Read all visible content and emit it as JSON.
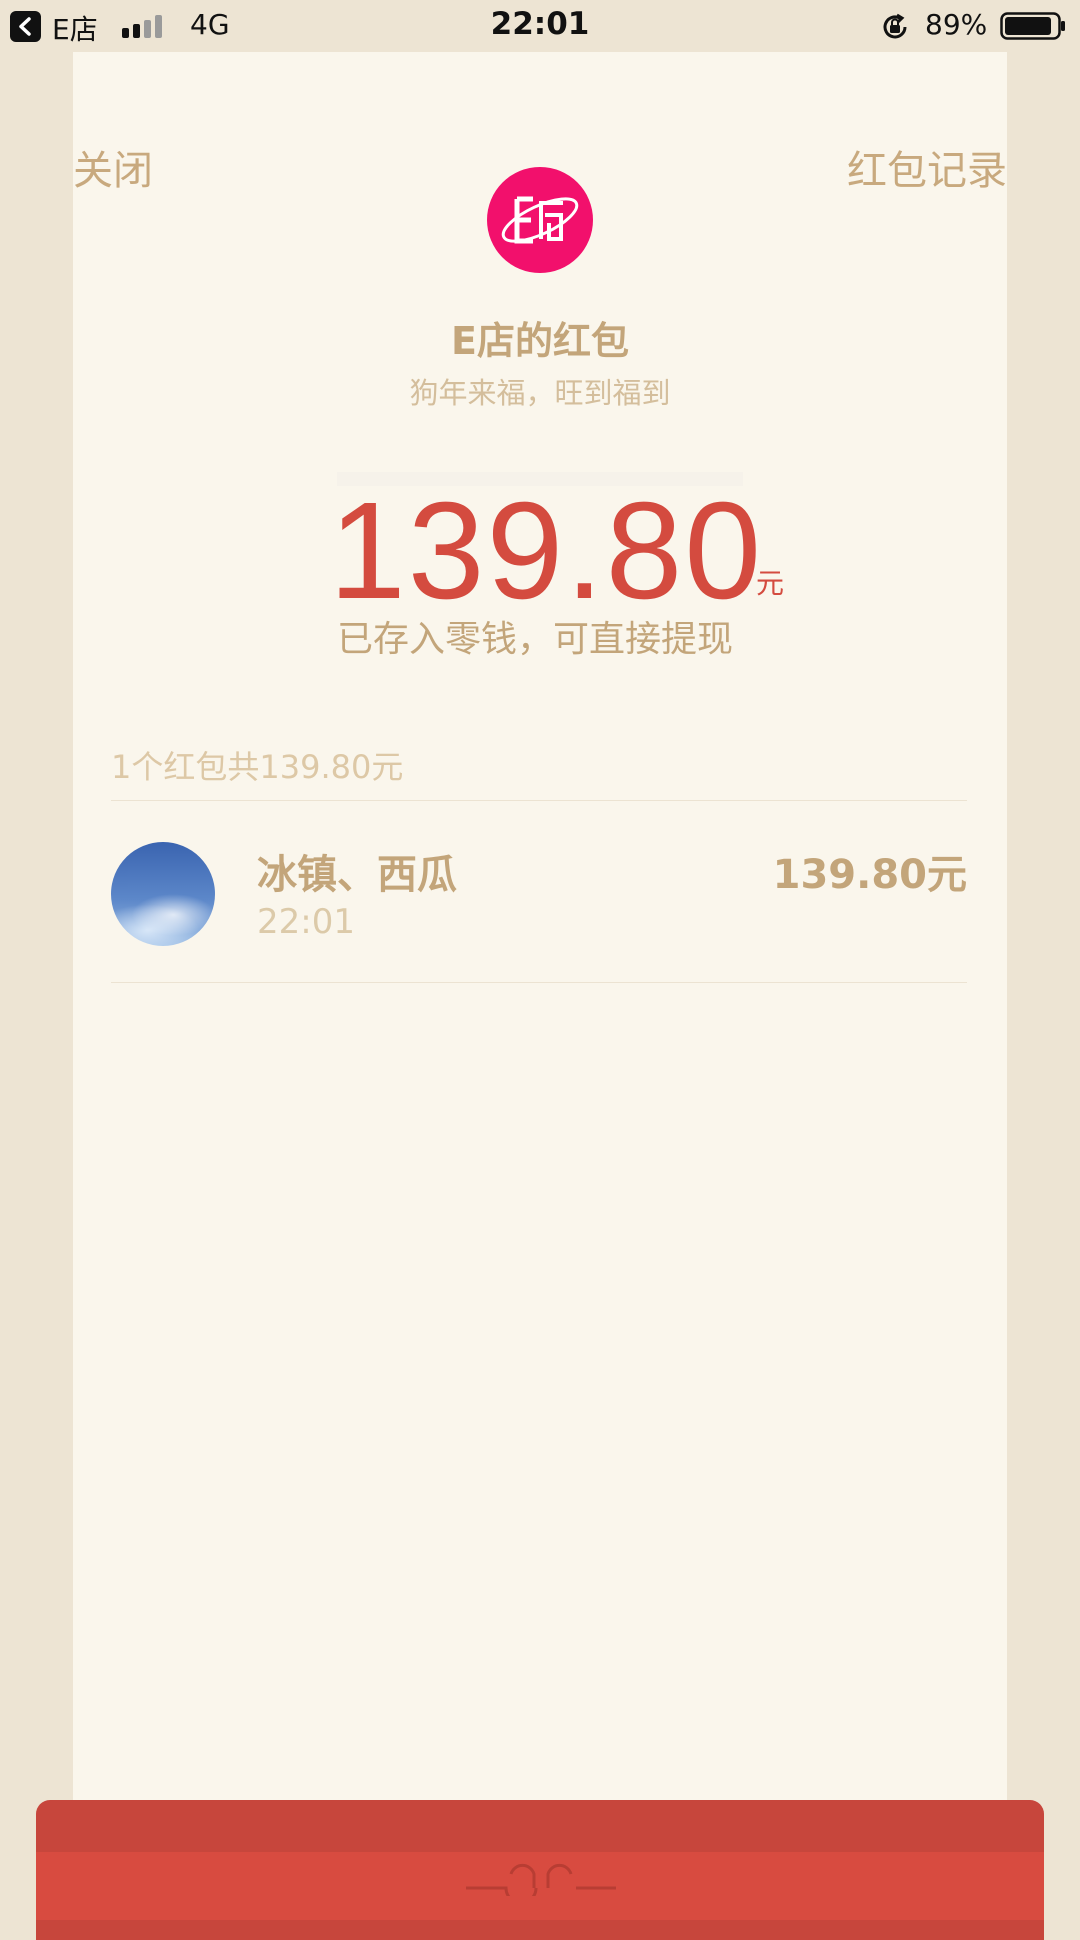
{
  "status_bar": {
    "back_app_label": "E店",
    "network": "4G",
    "time": "22:01",
    "battery_percent": "89%",
    "battery_level": 0.89
  },
  "header": {
    "close_label": "关闭",
    "records_label": "红包记录"
  },
  "envelope": {
    "sender_title": "E店的红包",
    "greeting": "狗年来福，旺到福到",
    "amount": "139.80",
    "unit": "元",
    "note": "已存入零钱，可直接提现"
  },
  "summary": {
    "text": "1个红包共139.80元"
  },
  "recipients": [
    {
      "name": "冰镇、西瓜",
      "time": "22:01",
      "amount": "139.80元"
    }
  ],
  "colors": {
    "accent_gold": "#c3a57a",
    "amount_red": "#d44b3f",
    "logo_pink": "#f2106c",
    "background": "#ede4d3",
    "card": "#faf6ec"
  },
  "icons": [
    "back-arrow-icon",
    "signal-icon",
    "rotation-lock-icon",
    "battery-icon",
    "shop-logo-icon"
  ]
}
